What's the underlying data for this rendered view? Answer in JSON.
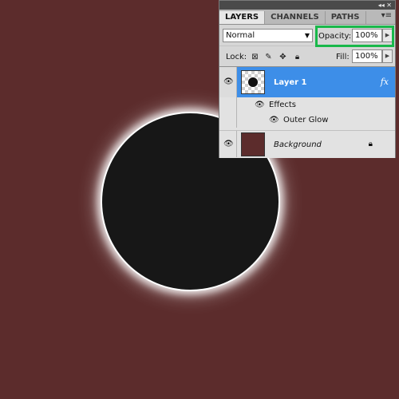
{
  "canvas": {
    "background_color": "#5c2c2c",
    "circle_color": "#171717",
    "glow_color": "#ffffff"
  },
  "panel": {
    "titlebar": {
      "collapse_icon": "double-chevron-left-icon",
      "close_icon": "close-icon"
    },
    "tabs": [
      {
        "label": "LAYERS",
        "active": true
      },
      {
        "label": "CHANNELS",
        "active": false
      },
      {
        "label": "PATHS",
        "active": false
      }
    ],
    "tab_menu_icon": "panel-menu-icon",
    "blend_mode": "Normal",
    "opacity_label": "Opacity:",
    "opacity_value": "100%",
    "lock_label": "Lock:",
    "fill_label": "Fill:",
    "fill_value": "100%",
    "highlight_color": "#19b84a",
    "layers": [
      {
        "name": "Layer 1",
        "selected": true,
        "fx_label": "fx"
      },
      {
        "name": "Effects"
      },
      {
        "name": "Outer Glow"
      },
      {
        "name": "Background"
      }
    ]
  }
}
